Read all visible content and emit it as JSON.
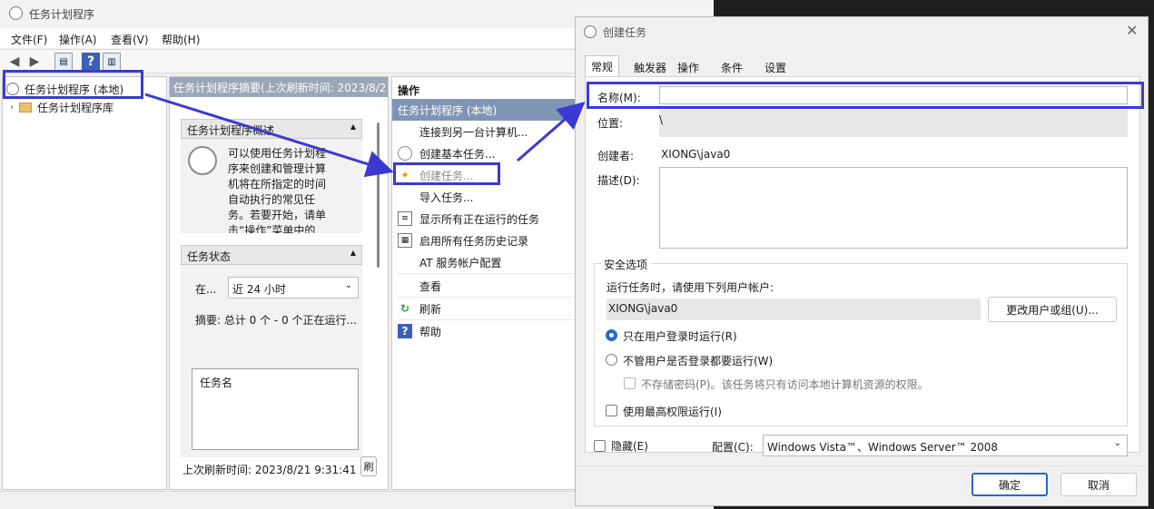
{
  "main_window": {
    "title": "任务计划程序",
    "menu": [
      "文件(F)",
      "操作(A)",
      "查看(V)",
      "帮助(H)"
    ]
  },
  "tree": {
    "root": "任务计划程序 (本地)",
    "library": "任务计划程序库"
  },
  "summary": {
    "header": "任务计划程序摘要(上次刷新时间: 2023/8/21",
    "overview_title": "任务计划程序概述",
    "overview_text": "可以使用任务计划程序来创建和管理计算机将在所指定的时间自动执行的常见任务。若要开始，请单击“操作”菜单中的",
    "status_title": "任务状态",
    "status_label": "在...",
    "status_range": "近 24 小时",
    "status_summary": "摘要: 总计 0 个 - 0 个正在运行...",
    "task_col": "任务名",
    "last_refresh": "上次刷新时间: 2023/8/21 9:31:41",
    "refresh_btn": "刷"
  },
  "actions": {
    "header": "操作",
    "section": "任务计划程序 (本地)",
    "items": [
      "连接到另一台计算机...",
      "创建基本任务...",
      "创建任务...",
      "导入任务...",
      "显示所有正在运行的任务",
      "启用所有任务历史记录",
      "AT 服务帐户配置",
      "查看",
      "刷新",
      "帮助"
    ]
  },
  "dialog": {
    "title": "创建任务",
    "tabs": [
      "常规",
      "触发器",
      "操作",
      "条件",
      "设置"
    ],
    "name_label": "名称(M):",
    "name_value": "",
    "location_label": "位置:",
    "location_value": "\\",
    "author_label": "创建者:",
    "author_value": "XIONG\\java0",
    "desc_label": "描述(D):",
    "security_title": "安全选项",
    "run_as_label": "运行任务时，请使用下列用户帐户:",
    "run_as_user": "XIONG\\java0",
    "change_user_btn": "更改用户或组(U)...",
    "radio_logged_on": "只在用户登录时运行(R)",
    "radio_any": "不管用户是否登录都要运行(W)",
    "no_store_pw": "不存储密码(P)。该任务将只有访问本地计算机资源的权限。",
    "highest_priv": "使用最高权限运行(I)",
    "hidden": "隐藏(E)",
    "config_label": "配置(C):",
    "config_value": "Windows Vista™、Windows Server™ 2008",
    "ok_btn": "确定",
    "cancel_btn": "取消"
  },
  "colors": {
    "highlight": "#3a3ad0",
    "header_blue": "#9aa7b8",
    "section_blue": "#7f95b5"
  }
}
